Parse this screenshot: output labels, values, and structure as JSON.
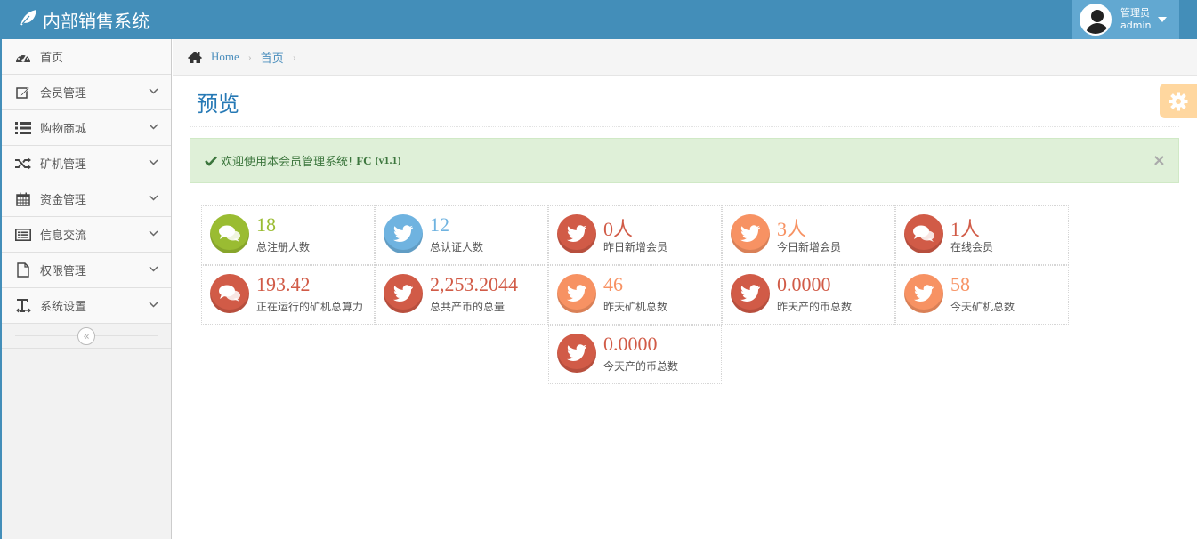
{
  "app": {
    "title": "内部销售系统"
  },
  "user": {
    "role": "管理员",
    "name": "admin"
  },
  "sidebar": {
    "items": [
      {
        "label": "首页",
        "icon": "dashboard-icon"
      },
      {
        "label": "会员管理",
        "icon": "edit-icon"
      },
      {
        "label": "购物商城",
        "icon": "list-icon"
      },
      {
        "label": "矿机管理",
        "icon": "random-icon"
      },
      {
        "label": "资金管理",
        "icon": "calendar-icon"
      },
      {
        "label": "信息交流",
        "icon": "list-alt-icon"
      },
      {
        "label": "权限管理",
        "icon": "file-icon"
      },
      {
        "label": "系统设置",
        "icon": "text-icon"
      }
    ]
  },
  "breadcrumb": {
    "home": "Home",
    "current": "首页"
  },
  "page": {
    "title": "预览"
  },
  "alert": {
    "text": "欢迎使用本会员管理系统!",
    "brand": "FC",
    "version": "(v1.1)"
  },
  "stats": [
    {
      "value": "18",
      "label": "总注册人数",
      "color": "#9abc32",
      "icon": "comments-icon"
    },
    {
      "value": "12",
      "label": "总认证人数",
      "color": "#6fb3e0",
      "icon": "twitter-icon"
    },
    {
      "value": "0人",
      "label": "昨日新增会员",
      "color": "#d15b47",
      "icon": "twitter-icon"
    },
    {
      "value": "3人",
      "label": "今日新增会员",
      "color": "#f79263",
      "icon": "twitter-icon"
    },
    {
      "value": "1人",
      "label": "在线会员",
      "color": "#d15b47",
      "icon": "comments-icon"
    },
    {
      "value": "193.42",
      "label": "正在运行的矿机总算力",
      "color": "#d15b47",
      "icon": "comments-icon"
    },
    {
      "value": "2,253.2044",
      "label": "总共产币的总量",
      "color": "#d15b47",
      "icon": "twitter-icon"
    },
    {
      "value": "46",
      "label": "昨天矿机总数",
      "color": "#f79263",
      "icon": "twitter-icon"
    },
    {
      "value": "0.0000",
      "label": "昨天产的币总数",
      "color": "#d15b47",
      "icon": "twitter-icon"
    },
    {
      "value": "58",
      "label": "今天矿机总数",
      "color": "#f79263",
      "icon": "twitter-icon"
    },
    {
      "value": "0.0000",
      "label": "今天产的币总数",
      "color": "#d15b47",
      "icon": "twitter-icon"
    }
  ],
  "colors": {
    "navbar": "#438eb9",
    "user_box": "#62a8d1",
    "title": "#2679b5",
    "link": "#4c8fbd"
  }
}
